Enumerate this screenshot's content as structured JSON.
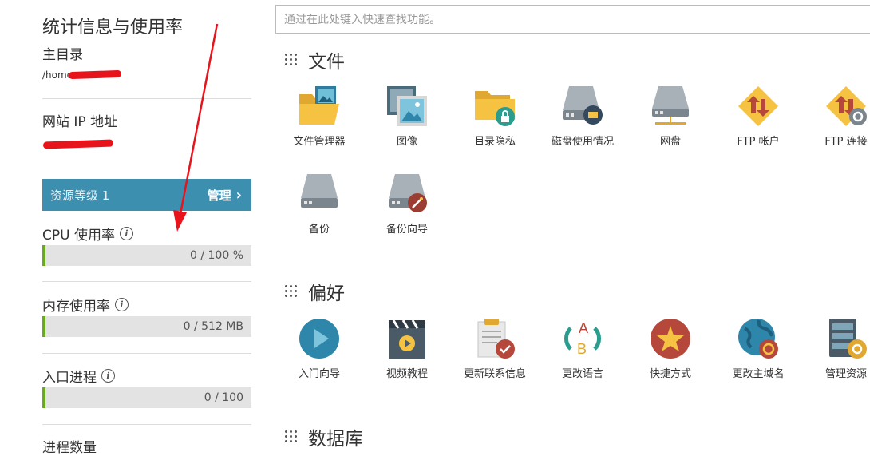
{
  "sidebar": {
    "title": "统计信息与使用率",
    "home_dir_label": "主目录",
    "home_dir_value": "/home",
    "ip_label": "网站 IP 地址",
    "resource": {
      "level": "资源等级 1",
      "manage": "管理",
      "chevron": "›"
    },
    "metrics": [
      {
        "label": "CPU 使用率",
        "value": "0 / 100 %",
        "fraction": 0
      },
      {
        "label": "内存使用率",
        "value": "0 / 512 MB",
        "fraction": 0
      },
      {
        "label": "入口进程",
        "value": "0 / 100",
        "fraction": 0
      }
    ],
    "process_count_label": "进程数量",
    "info_glyph": "i"
  },
  "search": {
    "placeholder": "通过在此处键入快速查找功能。"
  },
  "sections": [
    {
      "title": "文件",
      "items": [
        {
          "label": "文件管理器",
          "icon": "file-manager-icon"
        },
        {
          "label": "图像",
          "icon": "images-icon"
        },
        {
          "label": "目录隐私",
          "icon": "directory-privacy-icon"
        },
        {
          "label": "磁盘使用情况",
          "icon": "disk-usage-icon"
        },
        {
          "label": "网盘",
          "icon": "web-disk-icon"
        },
        {
          "label": "FTP 帐户",
          "icon": "ftp-accounts-icon"
        },
        {
          "label": "FTP 连接",
          "icon": "ftp-connections-icon"
        },
        {
          "label": "备份",
          "icon": "backup-icon"
        },
        {
          "label": "备份向导",
          "icon": "backup-wizard-icon"
        }
      ]
    },
    {
      "title": "偏好",
      "items": [
        {
          "label": "入门向导",
          "icon": "getting-started-icon"
        },
        {
          "label": "视频教程",
          "icon": "video-tutorials-icon"
        },
        {
          "label": "更新联系信息",
          "icon": "contact-info-icon"
        },
        {
          "label": "更改语言",
          "icon": "change-language-icon"
        },
        {
          "label": "快捷方式",
          "icon": "shortcuts-icon"
        },
        {
          "label": "更改主域名",
          "icon": "change-main-domain-icon"
        },
        {
          "label": "管理资源",
          "icon": "manage-resources-icon"
        }
      ]
    },
    {
      "title": "数据库",
      "items": []
    }
  ],
  "ab_letters": {
    "a": "A",
    "b": "B"
  },
  "colors": {
    "accent": "#3d8fb0",
    "progress": "#6aaa1e",
    "annotation_red": "#e8141b",
    "icon_yellow": "#f5c242",
    "icon_blue": "#2e86ab",
    "icon_red": "#b5483b"
  }
}
